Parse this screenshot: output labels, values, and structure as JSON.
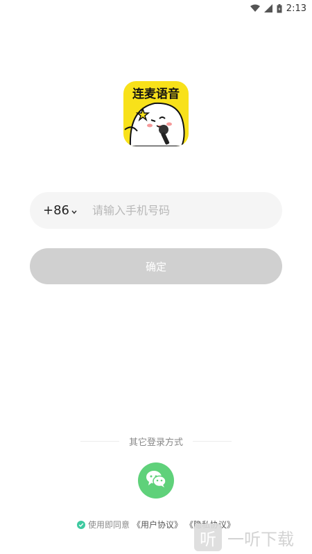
{
  "status_bar": {
    "time": "2:13",
    "icons": [
      "wifi-icon",
      "signal-icon",
      "battery-icon"
    ]
  },
  "logo": {
    "text": "连麦语音",
    "background_color": "#f8e11a"
  },
  "phone": {
    "country_code": "+86",
    "placeholder": "请输入手机号码",
    "value": ""
  },
  "confirm_button": {
    "label": "确定",
    "state": "disabled"
  },
  "other_login": {
    "title": "其它登录方式",
    "options": [
      "wechat-icon"
    ]
  },
  "agreement": {
    "prefix": "使用即同意",
    "user_agreement": "《用户协议》",
    "privacy_policy": "《隐私协议》"
  },
  "watermark": {
    "text": "一听下载",
    "icon_char": "听"
  },
  "colors": {
    "accent_green": "#5fd17a",
    "check_green": "#3ec9a0",
    "button_disabled": "#d0d0d0"
  }
}
